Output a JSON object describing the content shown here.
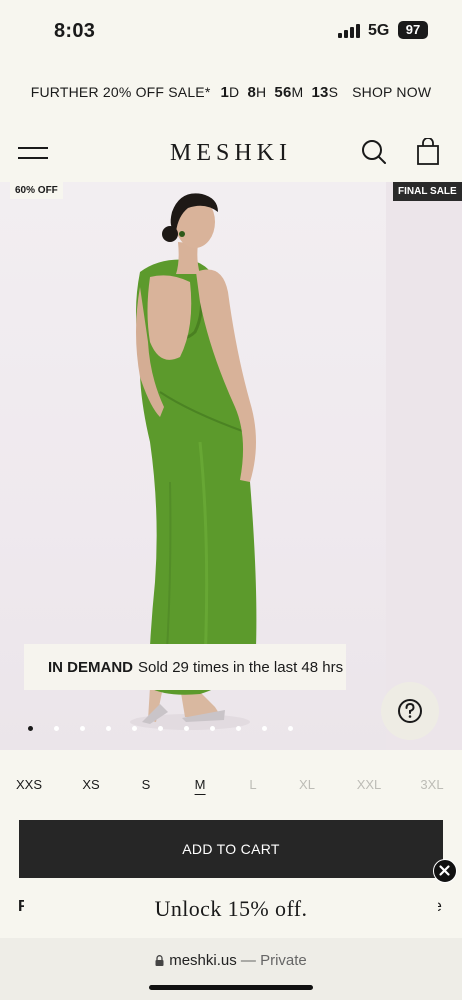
{
  "status_bar": {
    "time": "8:03",
    "network": "5G",
    "battery": "97"
  },
  "promo": {
    "text": "FURTHER 20% OFF SALE*",
    "countdown": [
      {
        "value": "1",
        "unit": "D"
      },
      {
        "value": "8",
        "unit": "H"
      },
      {
        "value": "56",
        "unit": "M"
      },
      {
        "value": "13",
        "unit": "S"
      }
    ],
    "cta": "SHOP NOW"
  },
  "header": {
    "logo": "MESHKI"
  },
  "hero": {
    "discount_badge": "60% OFF",
    "final_sale_badge": "FINAL SALE",
    "demand_label": "IN DEMAND",
    "demand_text": "Sold 29 times in the last 48 hrs",
    "help_icon": "question-icon"
  },
  "sizes": [
    {
      "label": "XXS",
      "available": true
    },
    {
      "label": "XS",
      "available": true
    },
    {
      "label": "S",
      "available": true
    },
    {
      "label": "M",
      "available": true,
      "selected": true
    },
    {
      "label": "L",
      "available": false
    },
    {
      "label": "XL",
      "available": false
    },
    {
      "label": "XXL",
      "available": false
    },
    {
      "label": "3XL",
      "available": false
    }
  ],
  "actions": {
    "add_to_cart": "ADD TO CART"
  },
  "popup": {
    "text": "Unlock 15% off.",
    "partial_left": "F",
    "partial_right": "e"
  },
  "browser": {
    "url": "meshki.us",
    "separator": " — ",
    "mode": "Private"
  },
  "colors": {
    "accent": "#262626",
    "background": "#f7f6ef",
    "dress": "#5c9a2c"
  }
}
